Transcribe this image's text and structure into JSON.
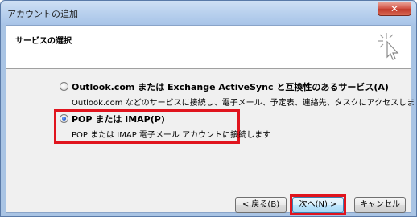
{
  "window": {
    "title": "アカウントの追加",
    "close_glyph": "✕"
  },
  "header": {
    "title": "サービスの選択",
    "icon": "sparkle-cursor-icon"
  },
  "options": [
    {
      "label": "Outlook.com または Exchange ActiveSync と互換性のあるサービス(A)",
      "description": "Outlook.com などのサービスに接続し、電子メール、予定表、連絡先、タスクにアクセスします",
      "selected": false
    },
    {
      "label": "POP または IMAP(P)",
      "description": "POP または IMAP 電子メール アカウントに接続します",
      "selected": true
    }
  ],
  "buttons": {
    "back": "< 戻る(B)",
    "next": "次へ(N) >",
    "cancel": "キャンセル"
  },
  "colors": {
    "highlight": "#e0141e",
    "titlebar": "#b9d1ee"
  }
}
